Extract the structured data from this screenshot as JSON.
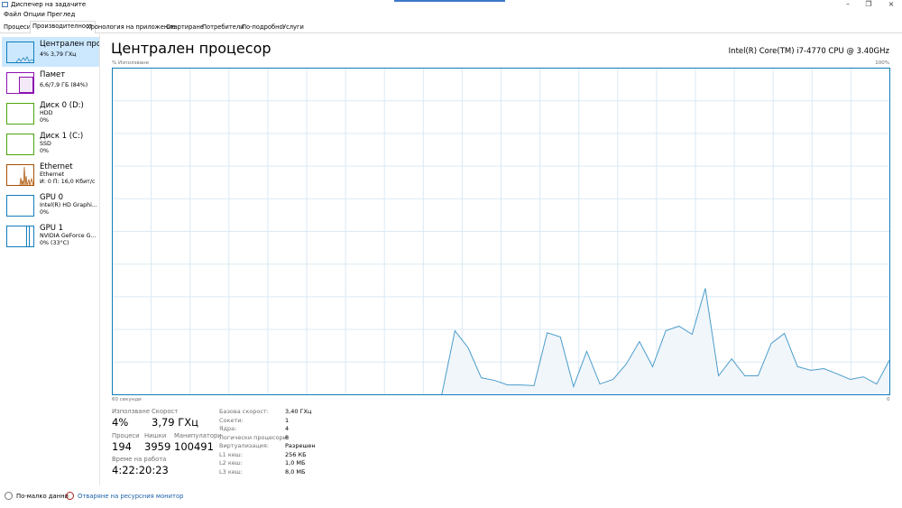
{
  "window": {
    "title": "Диспечер на задачите",
    "minimize": "–",
    "restore": "❐",
    "close": "×"
  },
  "menu": [
    "Файл",
    "Опции",
    "Преглед"
  ],
  "tabs": [
    "Процеси",
    "Производителност",
    "Хронология на приложение",
    "Стартиране",
    "Потребители",
    "По-подробно",
    "Услуги"
  ],
  "active_tab": 1,
  "sidebar": [
    {
      "name": "Централен процесор",
      "sub1": "4% 3,79 ГХц",
      "sub2": "",
      "color": "#117dbb"
    },
    {
      "name": "Памет",
      "sub1": "6,6/7,9 ГБ (84%)",
      "sub2": "",
      "color": "#8b12ae"
    },
    {
      "name": "Диск 0 (D:)",
      "sub1": "HDD",
      "sub2": "0%",
      "color": "#4da60c"
    },
    {
      "name": "Диск 1 (C:)",
      "sub1": "SSD",
      "sub2": "0%",
      "color": "#4da60c"
    },
    {
      "name": "Ethernet",
      "sub1": "Ethernet",
      "sub2": "И: 0 П: 16,0 Кбит/с",
      "color": "#a74f01"
    },
    {
      "name": "GPU 0",
      "sub1": "Intel(R) HD Graphi...",
      "sub2": "0%",
      "color": "#117dbb"
    },
    {
      "name": "GPU 1",
      "sub1": "NVIDIA GeForce G...",
      "sub2": "0% (33°C)",
      "color": "#117dbb"
    }
  ],
  "main": {
    "title": "Централен процесор",
    "cpu_model": "Intel(R) Core(TM) i7-4770 CPU @ 3.40GHz"
  },
  "chart_data": {
    "type": "area",
    "ylabel": "% Използване",
    "ymax_label": "100%",
    "xlabel_left": "60 секунди",
    "xlabel_right": "0",
    "ylim": [
      0,
      100
    ],
    "xlim": [
      60,
      0
    ],
    "grid": true,
    "line_color": "#117dbb",
    "fill_color": "#f1f6fa",
    "values": [
      0,
      0,
      0,
      0,
      0,
      0,
      0,
      0,
      0,
      0,
      0,
      0,
      0,
      0,
      0,
      0,
      0,
      0,
      0,
      0,
      0,
      0,
      0,
      0,
      0,
      0,
      19.6,
      14.4,
      5.2,
      4.4,
      3.0,
      3.0,
      2.8,
      19.0,
      17.7,
      2.5,
      13.3,
      3.3,
      4.7,
      9.4,
      16.3,
      8.6,
      19.6,
      21.0,
      18.5,
      32.6,
      5.8,
      11.0,
      5.8,
      5.8,
      15.7,
      18.8,
      8.6,
      7.5,
      8.0,
      6.4,
      4.7,
      5.5,
      3.3,
      10.8
    ]
  },
  "stats": {
    "usage_label": "Използване",
    "usage": "4%",
    "speed_label": "Скорост",
    "speed": "3,79 ГХц",
    "processes_label": "Процеси",
    "processes": "194",
    "threads_label": "Нишки",
    "threads": "3959",
    "handles_label": "Манипулатори",
    "handles": "100491",
    "uptime_label": "Време на работа",
    "uptime": "4:22:20:23"
  },
  "specs": [
    {
      "label": "Базова скорост:",
      "value": "3,40 ГХц"
    },
    {
      "label": "Сокети:",
      "value": "1"
    },
    {
      "label": "Ядра:",
      "value": "4"
    },
    {
      "label": "Логически процесори:",
      "value": "8"
    },
    {
      "label": "Виртуализация:",
      "value": "Разрешен"
    },
    {
      "label": "L1 кеш:",
      "value": "256 КБ"
    },
    {
      "label": "L2 кеш:",
      "value": "1,0 МБ"
    },
    {
      "label": "L3 кеш:",
      "value": "8,0 МБ"
    }
  ],
  "footer": {
    "fewer_details": "По-малко данни",
    "open_monitor": "Отваряне на ресурсния монитор"
  }
}
